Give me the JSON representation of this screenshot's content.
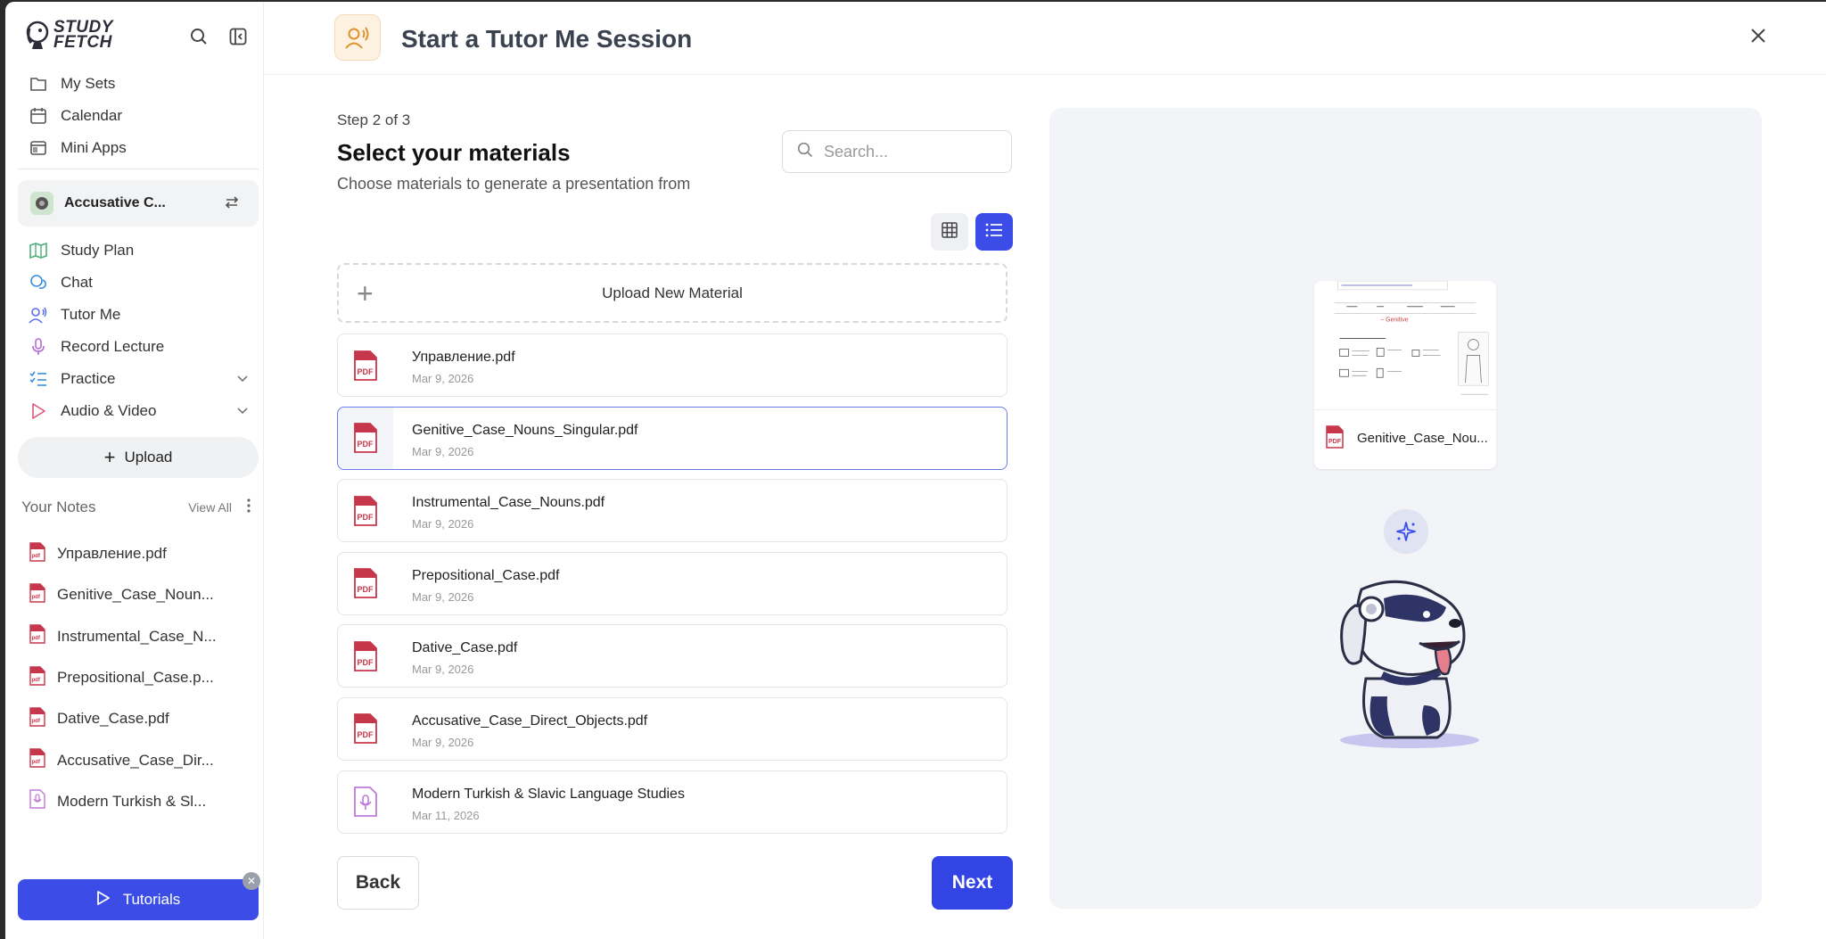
{
  "brand": {
    "line1": "STUDY",
    "line2": "FETCH"
  },
  "sidebar": {
    "nav_top": [
      {
        "label": "My Sets",
        "icon": "folder-icon"
      },
      {
        "label": "Calendar",
        "icon": "calendar-icon"
      },
      {
        "label": "Mini Apps",
        "icon": "mini-apps-icon"
      }
    ],
    "current_set": "Accusative C...",
    "nav_main": [
      {
        "label": "Study Plan",
        "icon": "map-icon"
      },
      {
        "label": "Chat",
        "icon": "chat-icon"
      },
      {
        "label": "Tutor Me",
        "icon": "tutor-icon"
      },
      {
        "label": "Record Lecture",
        "icon": "microphone-icon"
      },
      {
        "label": "Practice",
        "icon": "practice-icon"
      },
      {
        "label": "Audio & Video",
        "icon": "play-icon"
      }
    ],
    "upload_label": "Upload",
    "notes_title": "Your Notes",
    "view_all": "View All",
    "notes": [
      "Управление.pdf",
      "Genitive_Case_Noun...",
      "Instrumental_Case_N...",
      "Prepositional_Case.p...",
      "Dative_Case.pdf",
      "Accusative_Case_Dir...",
      "Modern Turkish & Sl..."
    ],
    "tutorials_label": "Tutorials"
  },
  "header": {
    "title": "Start a Tutor Me Session"
  },
  "main": {
    "step": "Step 2 of 3",
    "title": "Select your materials",
    "subtitle": "Choose materials to generate a presentation from",
    "search_placeholder": "Search...",
    "upload_new": "Upload New Material",
    "files": [
      {
        "name": "Управление.pdf",
        "date": "Mar 9, 2026",
        "type": "pdf"
      },
      {
        "name": "Genitive_Case_Nouns_Singular.pdf",
        "date": "Mar 9, 2026",
        "type": "pdf"
      },
      {
        "name": "Instrumental_Case_Nouns.pdf",
        "date": "Mar 9, 2026",
        "type": "pdf"
      },
      {
        "name": "Prepositional_Case.pdf",
        "date": "Mar 9, 2026",
        "type": "pdf"
      },
      {
        "name": "Dative_Case.pdf",
        "date": "Mar 9, 2026",
        "type": "pdf"
      },
      {
        "name": "Accusative_Case_Direct_Objects.pdf",
        "date": "Mar 9, 2026",
        "type": "pdf"
      },
      {
        "name": "Modern Turkish & Slavic Language Studies",
        "date": "Mar 11, 2026",
        "type": "audio"
      }
    ],
    "back_label": "Back",
    "next_label": "Next"
  },
  "preview": {
    "file_name": "Genitive_Case_Nou...",
    "thumb_heading": "− Genitive"
  },
  "colors": {
    "accent": "#3b4de6",
    "pdf_red": "#c7374b",
    "audio_purple": "#c07ad8"
  }
}
